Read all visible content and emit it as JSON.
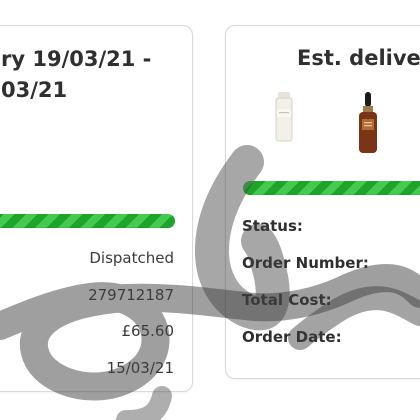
{
  "orders": {
    "left": {
      "title": "ry 19/03/21 - 03/21",
      "status_value": "Dispatched",
      "order_number_value": "279712187",
      "total_cost_value": "£65.60",
      "order_date_value": "15/03/21",
      "progress_fraction": 1.0
    },
    "right": {
      "title": "Est. delivery",
      "status_label": "Status:",
      "order_number_label": "Order Number:",
      "total_cost_label": "Total Cost:",
      "order_date_label": "Order Date:",
      "progress_fraction": 1.0
    }
  },
  "theme": {
    "accent": "#26b233",
    "text": "#2f2f2f",
    "card_border": "#d9d9d9"
  },
  "icons": {
    "cream": "cream-bottle-icon",
    "serum": "serum-bottle-icon"
  }
}
